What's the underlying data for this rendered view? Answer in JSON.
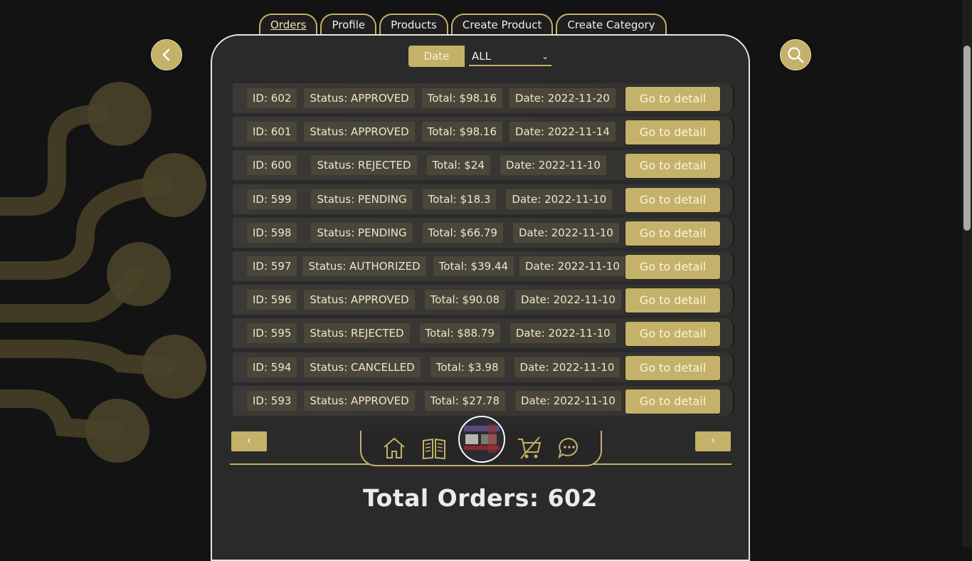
{
  "tabs": [
    {
      "label": "Orders",
      "active": true
    },
    {
      "label": "Profile"
    },
    {
      "label": "Products"
    },
    {
      "label": "Create Product"
    },
    {
      "label": "Create Category"
    }
  ],
  "filter": {
    "date_label": "Date",
    "status_select": {
      "selected": "ALL"
    }
  },
  "orders": [
    {
      "id": "ID: 602",
      "status": "Status: APPROVED",
      "total": "Total: $98.16",
      "date": "Date: 2022-11-20",
      "action": "Go to detail"
    },
    {
      "id": "ID: 601",
      "status": "Status: APPROVED",
      "total": "Total: $98.16",
      "date": "Date: 2022-11-14",
      "action": "Go to detail"
    },
    {
      "id": "ID: 600",
      "status": "Status: REJECTED",
      "total": "Total: $24",
      "date": "Date: 2022-11-10",
      "action": "Go to detail"
    },
    {
      "id": "ID: 599",
      "status": "Status: PENDING",
      "total": "Total: $18.3",
      "date": "Date: 2022-11-10",
      "action": "Go to detail"
    },
    {
      "id": "ID: 598",
      "status": "Status: PENDING",
      "total": "Total: $66.79",
      "date": "Date: 2022-11-10",
      "action": "Go to detail"
    },
    {
      "id": "ID: 597",
      "status": "Status: AUTHORIZED",
      "total": "Total: $39.44",
      "date": "Date: 2022-11-10",
      "action": "Go to detail"
    },
    {
      "id": "ID: 596",
      "status": "Status: APPROVED",
      "total": "Total: $90.08",
      "date": "Date: 2022-11-10",
      "action": "Go to detail"
    },
    {
      "id": "ID: 595",
      "status": "Status: REJECTED",
      "total": "Total: $88.79",
      "date": "Date: 2022-11-10",
      "action": "Go to detail"
    },
    {
      "id": "ID: 594",
      "status": "Status: CANCELLED",
      "total": "Total: $3.98",
      "date": "Date: 2022-11-10",
      "action": "Go to detail"
    },
    {
      "id": "ID: 593",
      "status": "Status: APPROVED",
      "total": "Total: $27.78",
      "date": "Date: 2022-11-10",
      "action": "Go to detail"
    }
  ],
  "pagination": {
    "prev": "‹",
    "next": "›"
  },
  "nav_icons": [
    "home-icon",
    "book-icon",
    "avatar",
    "cart-icon",
    "chat-icon"
  ],
  "summary": {
    "total_orders": "Total Orders: 602"
  },
  "colors": {
    "accent": "#c4b16a",
    "background": "#131313",
    "panel": "#2a2a2a"
  }
}
